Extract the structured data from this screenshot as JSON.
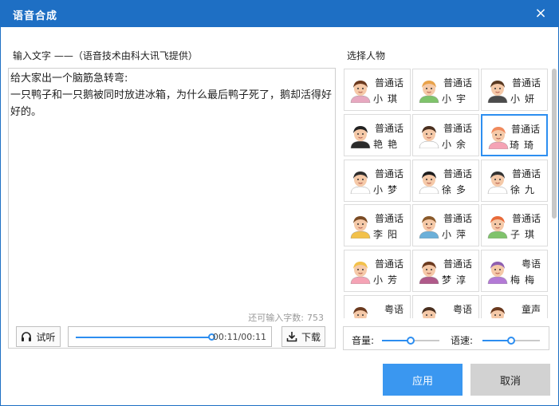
{
  "window": {
    "title": "语音合成",
    "close_icon": "×"
  },
  "input_section": {
    "label": "输入文字 ——（语音技术由科大讯飞提供）",
    "text": "给大家出一个脑筋急转弯:\n一只鸭子和一只鹅被同时放进冰箱，为什么最后鸭子死了，鹅却活得好好的。",
    "remaining_label": "还可输入字数:",
    "remaining_count": "753"
  },
  "player": {
    "listen_label": "试听",
    "time": "00:11/00:11",
    "progress_fraction": 1.0,
    "download_label": "下载"
  },
  "voice_section": {
    "label": "选择人物",
    "selected": "琦琦",
    "voices": [
      {
        "type": "普通话",
        "name": "小琪",
        "skin": "#f5c9a8",
        "hair": "#6b3a1f",
        "shirt": "#e7a8c0"
      },
      {
        "type": "普通话",
        "name": "小宇",
        "skin": "#f5c9a8",
        "hair": "#e8a24a",
        "shirt": "#7fc36b"
      },
      {
        "type": "普通话",
        "name": "小妍",
        "skin": "#f5c9a8",
        "hair": "#5a3a22",
        "shirt": "#4b4b4b"
      },
      {
        "type": "普通话",
        "name": "艳艳",
        "skin": "#f5c9a8",
        "hair": "#222222",
        "shirt": "#2a2a2a"
      },
      {
        "type": "普通话",
        "name": "小余",
        "skin": "#f5c9a8",
        "hair": "#4a3020",
        "shirt": "#ffffff"
      },
      {
        "type": "普通话",
        "name": "琦琦",
        "skin": "#f5c9a8",
        "hair": "#f08a5d",
        "shirt": "#f5a3b5"
      },
      {
        "type": "普通话",
        "name": "小梦",
        "skin": "#f5c9a8",
        "hair": "#2e2e2e",
        "shirt": "#ffffff"
      },
      {
        "type": "普通话",
        "name": "徐多",
        "skin": "#f5c9a8",
        "hair": "#1d1d1d",
        "shirt": "#ffffff"
      },
      {
        "type": "普通话",
        "name": "徐九",
        "skin": "#f5c9a8",
        "hair": "#333333",
        "shirt": "#ffffff"
      },
      {
        "type": "普通话",
        "name": "李阳",
        "skin": "#f5c9a8",
        "hair": "#7a4b24",
        "shirt": "#f2c14a"
      },
      {
        "type": "普通话",
        "name": "小萍",
        "skin": "#f5c9a8",
        "hair": "#8a5a2b",
        "shirt": "#6bb0d9"
      },
      {
        "type": "普通话",
        "name": "子琪",
        "skin": "#f5c9a8",
        "hair": "#e86b3a",
        "shirt": "#7fc36b"
      },
      {
        "type": "普通话",
        "name": "小芳",
        "skin": "#f5c9a8",
        "hair": "#f2c14a",
        "shirt": "#f5a3b5"
      },
      {
        "type": "普通话",
        "name": "梦淳",
        "skin": "#f5c9a8",
        "hair": "#6b3a1f",
        "shirt": "#b05a8a"
      },
      {
        "type": "粤语",
        "name": "梅梅",
        "skin": "#f5c9a8",
        "hair": "#8e5fb0",
        "shirt": "#b37ad6"
      },
      {
        "type": "粤语",
        "name": "",
        "skin": "#f5c9a8",
        "hair": "#6b3a1f",
        "shirt": "#ffffff"
      },
      {
        "type": "粤语",
        "name": "",
        "skin": "#f5c9a8",
        "hair": "#4a3020",
        "shirt": "#ffffff"
      },
      {
        "type": "童声",
        "name": "",
        "skin": "#f5c9a8",
        "hair": "#6b3a1f",
        "shirt": "#ffffff"
      }
    ]
  },
  "controls": {
    "volume_label": "音量:",
    "volume_fraction": 0.5,
    "speed_label": "语速:",
    "speed_fraction": 0.5
  },
  "buttons": {
    "apply": "应用",
    "cancel": "取消"
  },
  "colors": {
    "titlebar": "#1e6fc4",
    "accent": "#2d8ef0",
    "apply": "#3a97f0"
  }
}
